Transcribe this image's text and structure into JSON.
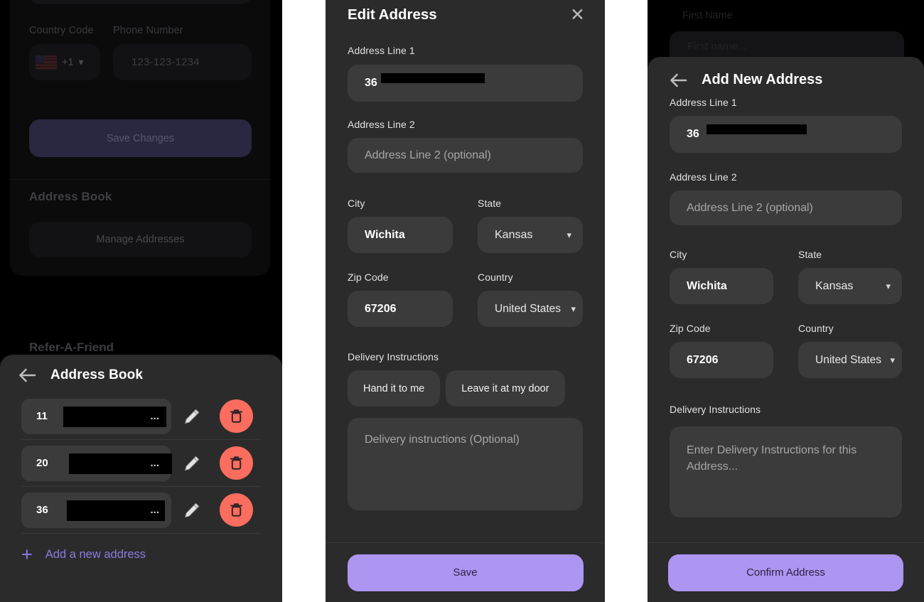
{
  "colors": {
    "accent_purple": "#ad95f2",
    "link_purple": "#8c7be0",
    "delete_coral": "#fb6d5f",
    "sheet_bg": "#2b2b2b",
    "field_bg": "#3b3b3b",
    "page_black": "#000000"
  },
  "left_panel": {
    "background_form": {
      "country_code_label": "Country Code",
      "phone_number_label": "Phone Number",
      "country_code_value": "+1",
      "phone_placeholder": "123-123-1234",
      "save_changes_label": "Save Changes",
      "address_book_heading": "Address Book",
      "manage_addresses_label": "Manage Addresses",
      "refer_a_friend_heading": "Refer-A-Friend"
    },
    "sheet": {
      "back_icon": "arrow-left-icon",
      "title": "Address Book",
      "rows": [
        {
          "prefix": "11",
          "redacted": true,
          "ellipsis": "...",
          "edit_icon": "pencil-icon",
          "delete_icon": "trash-icon"
        },
        {
          "prefix": "20",
          "redacted": true,
          "ellipsis": "...",
          "edit_icon": "pencil-icon",
          "delete_icon": "trash-icon"
        },
        {
          "prefix": "36",
          "redacted": true,
          "ellipsis": "...",
          "edit_icon": "pencil-icon",
          "delete_icon": "trash-icon"
        }
      ],
      "add_new_icon": "plus-icon",
      "add_new_label": "Add a new address"
    }
  },
  "middle_panel": {
    "title": "Edit Address",
    "close_icon": "close-icon",
    "address_line_1": {
      "label": "Address Line 1",
      "value": "36",
      "redacted": true
    },
    "address_line_2": {
      "label": "Address Line 2",
      "placeholder": "Address Line 2 (optional)"
    },
    "city": {
      "label": "City",
      "value": "Wichita"
    },
    "state": {
      "label": "State",
      "value": "Kansas",
      "icon": "chevron-down-icon"
    },
    "zip": {
      "label": "Zip Code",
      "value": "67206"
    },
    "country": {
      "label": "Country",
      "value": "United States",
      "icon": "chevron-down-icon"
    },
    "delivery": {
      "label": "Delivery Instructions",
      "chips": [
        "Hand it to me",
        "Leave it at my door"
      ],
      "placeholder": "Delivery instructions (Optional)"
    },
    "submit_label": "Save"
  },
  "right_panel": {
    "background_form": {
      "first_name_label": "First Name",
      "first_name_placeholder": "First name..."
    },
    "back_icon": "arrow-left-icon",
    "title": "Add New Address",
    "address_line_1": {
      "label": "Address Line 1",
      "value": "36",
      "redacted": true
    },
    "address_line_2": {
      "label": "Address Line 2",
      "placeholder": "Address Line 2 (optional)"
    },
    "city": {
      "label": "City",
      "value": "Wichita"
    },
    "state": {
      "label": "State",
      "value": "Kansas",
      "icon": "chevron-down-icon"
    },
    "zip": {
      "label": "Zip Code",
      "value": "67206"
    },
    "country": {
      "label": "Country",
      "value": "United States",
      "icon": "chevron-down-icon"
    },
    "delivery": {
      "label": "Delivery Instructions",
      "placeholder": "Enter Delivery Instructions for this Address..."
    },
    "submit_label": "Confirm Address"
  }
}
